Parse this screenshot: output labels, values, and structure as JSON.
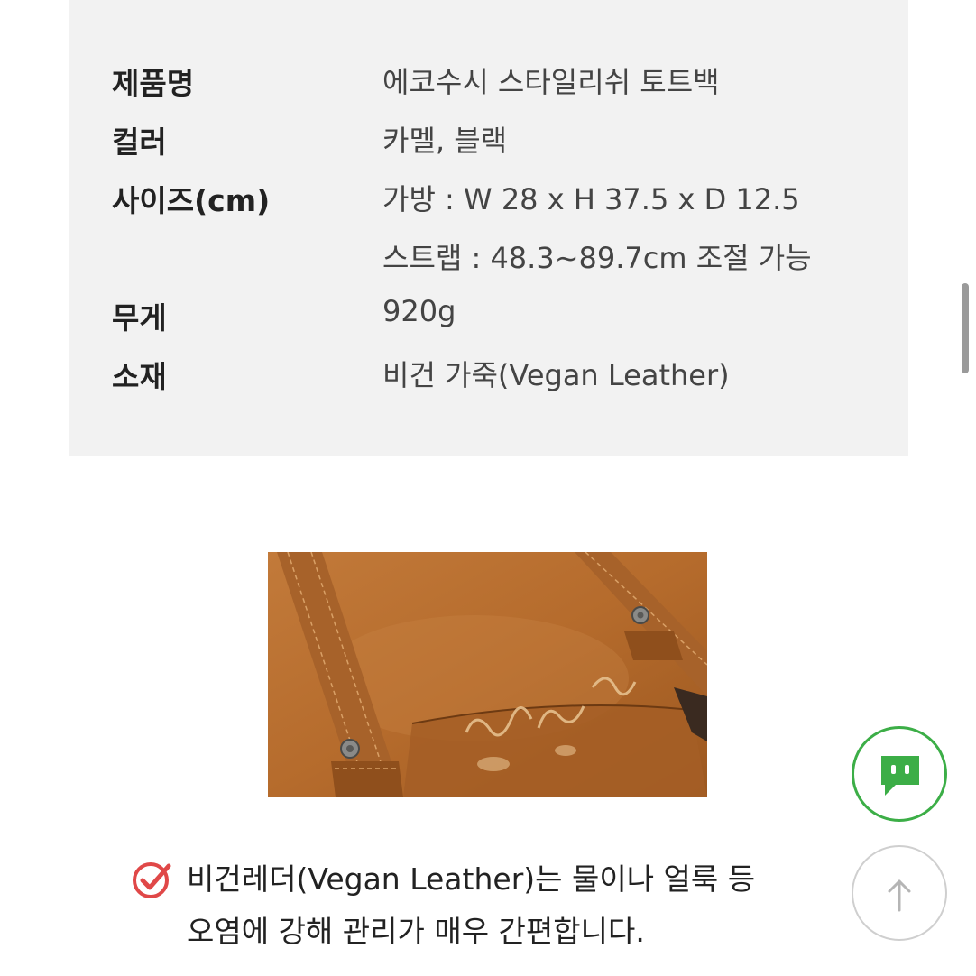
{
  "spec": {
    "rows": [
      {
        "label": "제품명",
        "value": "에코수시 스타일리쉬 토트백"
      },
      {
        "label": "컬러",
        "value": "카멜, 블랙"
      },
      {
        "label": "사이즈(cm)",
        "value": "가방 : W 28 x H 37.5 x D 12.5"
      },
      {
        "label": "",
        "value": "스트랩 : 48.3~89.7cm 조절 가능"
      },
      {
        "label": "무게",
        "value": "920g"
      },
      {
        "label": "소재",
        "value": "비건 가죽(Vegan Leather)"
      }
    ]
  },
  "photo": {
    "subject": "camel vegan leather tote bag with water droplets"
  },
  "note": {
    "icon": "check-circle-icon",
    "line1": "비건레더(Vegan Leather)는 물이나 얼룩 등",
    "line2": "오염에 강해 관리가 매우 간편합니다."
  },
  "buttons": {
    "chat_icon": "chat-icon",
    "top_icon": "arrow-up-icon"
  },
  "colors": {
    "panel_bg": "#f2f2f2",
    "accent_green": "#3cae47",
    "check_red": "#e04848",
    "leather": "#b06a2e"
  }
}
